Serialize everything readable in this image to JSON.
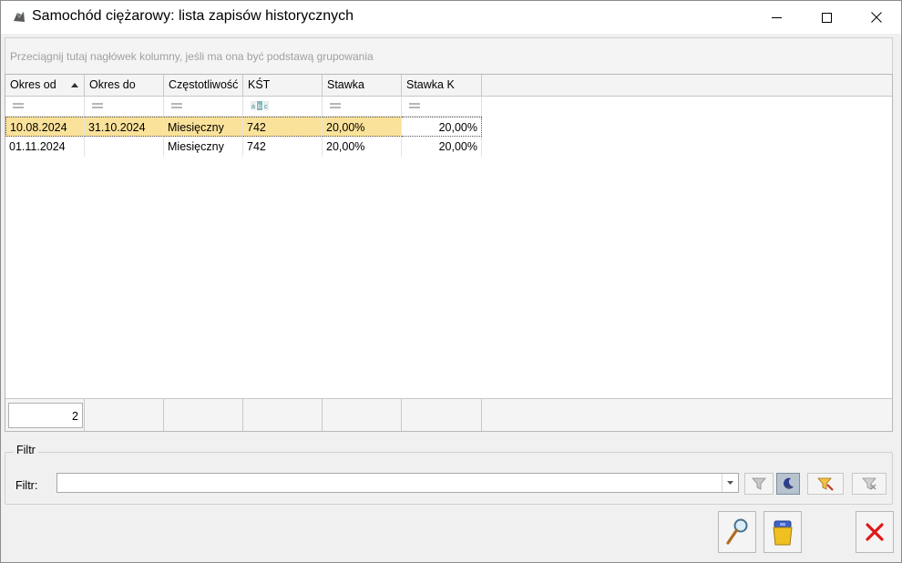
{
  "window": {
    "title": "Samochód ciężarowy: lista zapisów historycznych",
    "accent": "#fbe29a"
  },
  "group_panel": {
    "hint": "Przeciągnij tutaj nagłówek kolumny, jeśli ma ona być podstawą grupowania"
  },
  "grid": {
    "columns": [
      {
        "label": "Okres od",
        "sorted": "ascending"
      },
      {
        "label": "Okres do"
      },
      {
        "label": "Częstotliwość"
      },
      {
        "label": "KŚT"
      },
      {
        "label": "Stawka"
      },
      {
        "label": "Stawka K"
      }
    ],
    "filter_icons": [
      "equals-icon",
      "equals-icon",
      "equals-icon",
      "abc-icon",
      "equals-icon",
      "equals-icon"
    ],
    "rows": [
      {
        "selected": true,
        "cells": [
          "10.08.2024",
          "31.10.2024",
          "Miesięczny",
          "742",
          "20,00%",
          "20,00%"
        ]
      },
      {
        "selected": false,
        "cells": [
          "01.11.2024",
          "",
          "Miesięczny",
          "742",
          "20,00%",
          "20,00%"
        ]
      }
    ],
    "footer_count": "2"
  },
  "filter": {
    "group_label": "Filtr",
    "label": "Filtr:",
    "value": ""
  },
  "buttons": {
    "filter_icons": [
      "funnel-icon",
      "moon-icon",
      "funnel-color-icon",
      "funnel-clear-icon"
    ],
    "actions": [
      "magnifier-icon",
      "bin-icon",
      "close-x-icon"
    ]
  }
}
